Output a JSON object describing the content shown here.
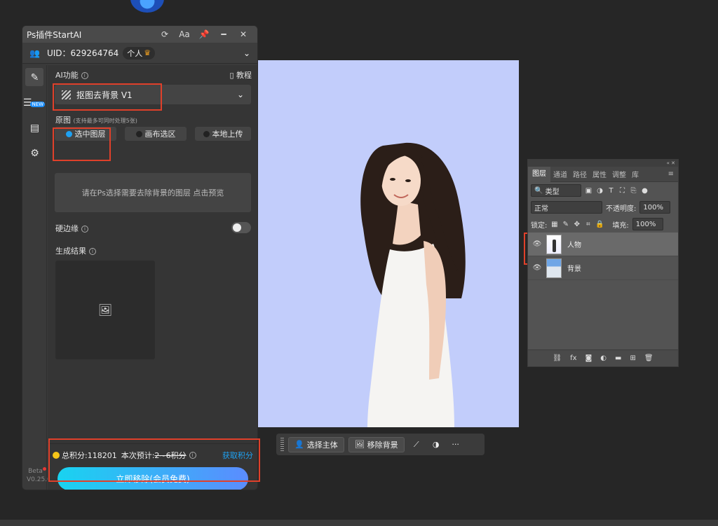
{
  "plugin": {
    "title": "Ps插件StartAI",
    "title_buttons": [
      "refresh-icon",
      "font-size-icon",
      "pin-icon",
      "minimize-icon",
      "close-icon"
    ],
    "font_btn_label": "Aa",
    "uid_text": "UID：629264764",
    "plan_label": "个人",
    "rail_new_badge": "NEW",
    "version_beta": "Beta",
    "version": "V0.25.0",
    "ai_section_label": "AI功能",
    "tutorial_label": "教程",
    "feature_dropdown": "抠图去背景 V1",
    "source_label": "原图",
    "source_hint": "(支持最多可同时处理5张)",
    "source_options": [
      {
        "label": "选中图层",
        "selected": true
      },
      {
        "label": "画布选区",
        "selected": false
      },
      {
        "label": "本地上传",
        "selected": false
      }
    ],
    "source_placeholder": "请在Ps选择需要去除背景的图层 点击预览",
    "hard_edge_label": "硬边缘",
    "hard_edge_on": false,
    "result_label": "生成结果",
    "points_text": "总积分:118201",
    "estimate_prefix": "本次预计:",
    "estimate_value": "2~6积分",
    "get_points_label": "获取积分",
    "action_button": "立即移除(会员免费)",
    "accent_color": "#1ea1f2"
  },
  "layers_panel": {
    "tabs": [
      "图层",
      "通道",
      "路径",
      "属性",
      "调整",
      "库"
    ],
    "active_tab": "图层",
    "filter_kind": "类型",
    "blend_mode": "正常",
    "opacity_label": "不透明度:",
    "opacity_value": "100%",
    "lock_label": "锁定:",
    "fill_label": "填充:",
    "fill_value": "100%",
    "layers": [
      {
        "name": "人物",
        "selected": true
      },
      {
        "name": "背景",
        "selected": false
      }
    ]
  },
  "taskbar": {
    "select_subject": "选择主体",
    "remove_bg": "移除背景",
    "more": "···"
  }
}
